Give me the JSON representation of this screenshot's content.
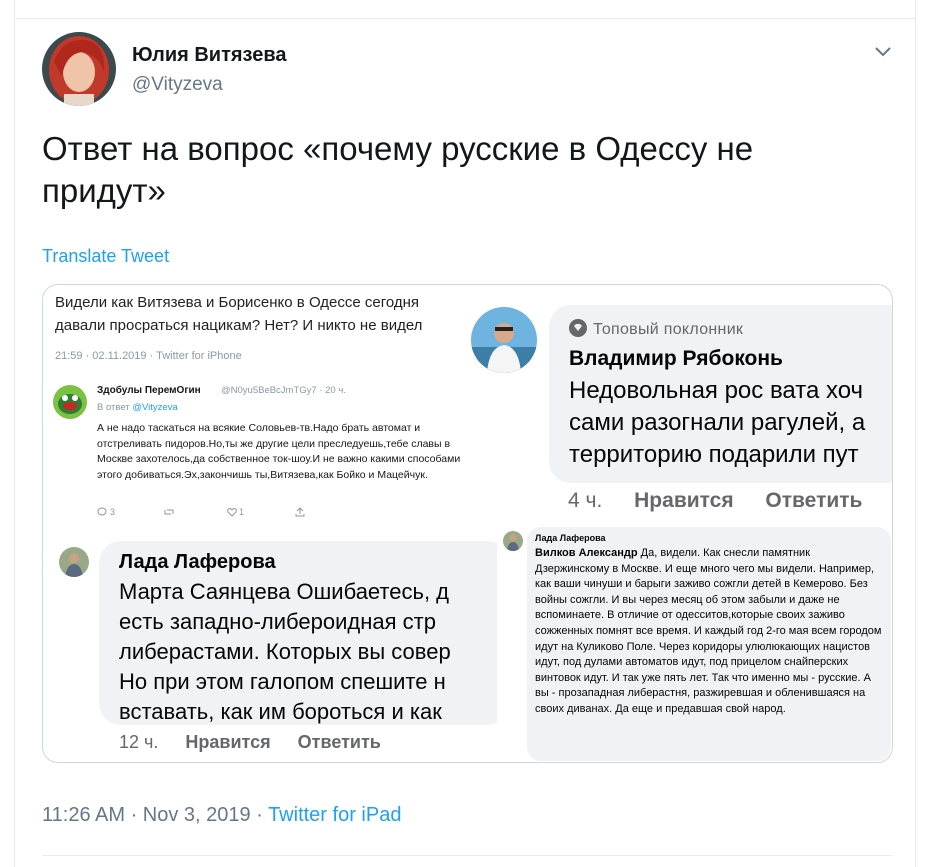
{
  "author": {
    "name": "Юлия Витязева",
    "handle": "@Vityzeva"
  },
  "tweet": {
    "text": "Ответ на вопрос «почему русские в Одессу не придут»",
    "translate_label": "Translate Tweet",
    "time": "11:26 AM · Nov 3, 2019 · ",
    "source": "Twitter for iPad"
  },
  "media": {
    "quoted_tweet": {
      "text": "Видели как Витязева и Борисенко в Одессе сегодня давали просраться нацикам? Нет? И никто не видел",
      "meta": "21:59 · 02.11.2019 · Twitter for iPhone",
      "reply": {
        "name": "Здобулы ПеремОгин",
        "handle": "@N0yu5BeBcJmTGy7 · 20 ч.",
        "in_reply_to_prefix": "В ответ ",
        "in_reply_to": "@Vityzeva",
        "body": "А не надо таскаться на всякие Соловьев-тв.Надо брать автомат и отстреливать пидоров.Но,ты же другие цели преследуешь,тебе славы в Москве захотелось,да собственное ток-шоу.И не важно какими способами этого добиваться.Эх,закончишь ты,Витязева,как Бойко и Мацейчук.",
        "actions": [
          "3",
          "",
          "1",
          ""
        ]
      }
    },
    "comment_top": {
      "badge": "Топовый поклонник",
      "name": "Владимир Рябоконь",
      "text_lines": [
        "Недовольная рос вата хоч",
        "сами разогнали рагулей, а",
        "территорию подарили пут"
      ],
      "time": "4 ч.",
      "like": "Нравится",
      "reply": "Ответить"
    },
    "comment_left": {
      "name": "Лада Лаферова",
      "text_lines": [
        "Марта Саянцева Ошибаетесь, д",
        "есть западно-либероидная стр",
        "либерастами. Которых вы совер",
        "Но при этом галопом спешите н",
        "вставать, как им бороться и как"
      ],
      "time": "12 ч.",
      "like": "Нравится",
      "reply": "Ответить"
    },
    "comment_right": {
      "name": "Лада Лаферова",
      "mention": "Вилков Александр",
      "text": " Да, видели. Как снесли памятник Дзержинскому в Москве. И еще много чего мы видели. Например, как ваши чинуши и барыги заживо сожгли детей в Кемерово. Без войны сожгли. И вы через месяц об этом забыли и даже не вспоминаете. В отличие от одесситов,которые своих заживо сожженных помнят все время. И каждый год 2-го мая всем городом идут на Куликово Поле. Через коридоры улюлюкающих нацистов идут, под дулами автоматов идут, под прицелом снайперских винтовок идут. И так уже пять лет. Так что именно мы - русские. А вы - прозападная либерастня, разжиревшая и обленившаяся на своих диванах. Да еще и предавшая свой народ."
    }
  }
}
